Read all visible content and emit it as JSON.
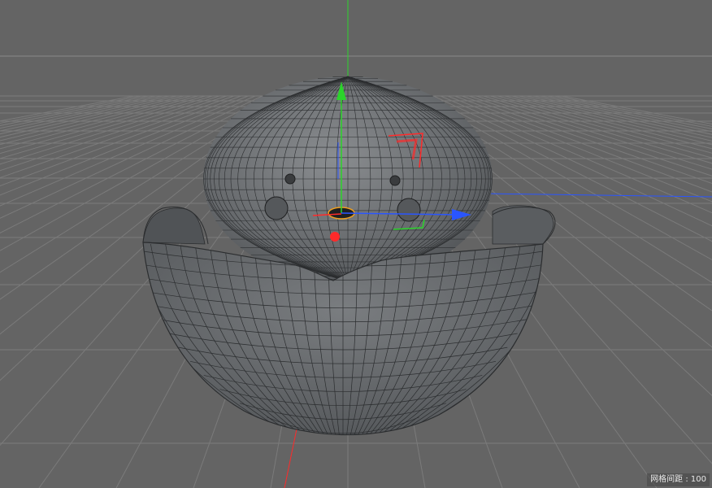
{
  "viewport": {
    "status": {
      "grid_spacing_label": "网格间距",
      "grid_spacing_value": "100",
      "text": "网格间距 : 100"
    }
  },
  "colors": {
    "background": "#646464",
    "grid_line": "#7a7a7a",
    "horizon_line": "#8a8a8a",
    "mesh_fill": "#6f7274",
    "mesh_wire": "#2b2d2f",
    "axis_x": "#ff2a2a",
    "axis_y": "#2bd42b",
    "axis_z": "#2a55ff",
    "pivot": "#f0a020"
  },
  "icons": [
    "move-gizmo-icon",
    "rotate-gizmo-icon"
  ]
}
